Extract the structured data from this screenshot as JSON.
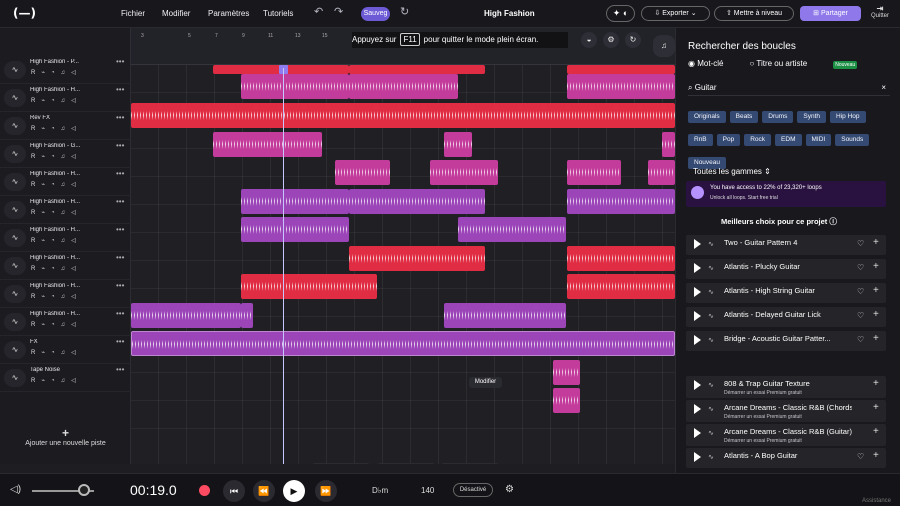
{
  "topbar": {
    "menu": [
      "Fichier",
      "Modifier",
      "Paramètres",
      "Tutoriels"
    ],
    "save": "Sauveg",
    "title": "High Fashion",
    "export": "Exporter",
    "upgrade": "Mettre à niveau",
    "share": "Partager",
    "quit": "Quitter"
  },
  "tracks": [
    {
      "name": "High Fashion - P..."
    },
    {
      "name": "High Fashion - H..."
    },
    {
      "name": "Rev FX"
    },
    {
      "name": "High Fashion - G..."
    },
    {
      "name": "High Fashion - H..."
    },
    {
      "name": "High Fashion - H..."
    },
    {
      "name": "High Fashion - H..."
    },
    {
      "name": "High Fashion - H..."
    },
    {
      "name": "High Fashion - H..."
    },
    {
      "name": "High Fashion - H..."
    },
    {
      "name": "FX"
    },
    {
      "name": "Tape Noise"
    }
  ],
  "add_track": "Ajouter une nouvelle piste",
  "timeline": {
    "ticks": [
      "3",
      "5",
      "7",
      "9",
      "11",
      "13",
      "15"
    ],
    "fullscreen_before": "Appuyez sur",
    "fullscreen_key": "F11",
    "fullscreen_after": "pour quitter le mode plein écran.",
    "edit_label": "Modifier"
  },
  "sidebar": {
    "title": "Rechercher des boucles",
    "radio_keyword": "Mot-clé",
    "radio_title": "Titre ou artiste",
    "new_tag": "Nouveau",
    "search_value": "Guitar",
    "tags": [
      "Originals",
      "Beats",
      "Drums",
      "Synth",
      "Hip Hop",
      "RnB",
      "Pop",
      "Rock",
      "EDM",
      "MIDI",
      "Sounds",
      "Nouveau"
    ],
    "scales": "Toutes les gammes",
    "promo_main": "You have access to 22% of 23,320+ loops",
    "promo_sub": "Unlock all loops. Start free trial",
    "best": "Meilleurs choix pour ce projet",
    "loops": [
      {
        "name": "Two - Guitar Pattern 4",
        "sub": ""
      },
      {
        "name": "Atlantis - Plucky Guitar",
        "sub": ""
      },
      {
        "name": "Atlantis - High String Guitar",
        "sub": ""
      },
      {
        "name": "Atlantis - Delayed Guitar Lick",
        "sub": ""
      },
      {
        "name": "Bridge - Acoustic Guitar Patter...",
        "sub": ""
      },
      {
        "name": "808 & Trap Guitar Texture",
        "sub": "Démarrer un essai Premium gratuit"
      },
      {
        "name": "Arcane Dreams - Classic R&B (Chords)",
        "sub": "Démarrer un essai Premium gratuit"
      },
      {
        "name": "Arcane Dreams - Classic R&B (Guitar)",
        "sub": "Démarrer un essai Premium gratuit"
      },
      {
        "name": "Atlantis - A Bop Guitar",
        "sub": ""
      }
    ]
  },
  "bottom": {
    "time": "00:19.0",
    "key": "D♭m",
    "bpm": "140",
    "toggle": "Désactivé",
    "assistance": "Assistance"
  },
  "colors": {
    "accent": "#8e78ea",
    "red": "#e02d43",
    "pink": "#c43c9b",
    "purple": "#9b45b8"
  }
}
